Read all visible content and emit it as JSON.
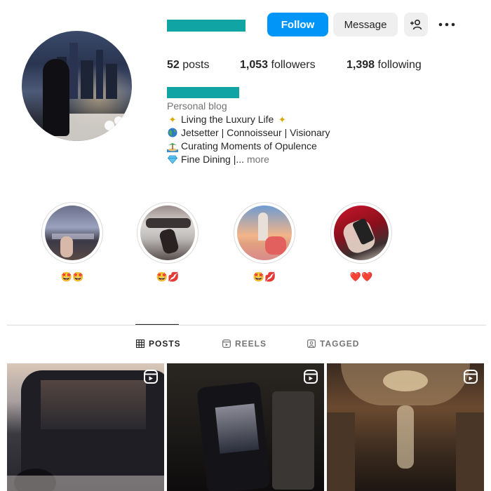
{
  "header": {
    "follow_label": "Follow",
    "message_label": "Message",
    "adduser_icon": "add-user-icon",
    "more_icon": "more-horizontal-icon"
  },
  "stats": {
    "posts_count": "52",
    "posts_label": "posts",
    "followers_count": "1,053",
    "followers_label": "followers",
    "following_count": "1,398",
    "following_label": "following"
  },
  "bio": {
    "category": "Personal blog",
    "line1": "Living the Luxury Life",
    "line2": "Jetsetter | Connoisseur | Visionary",
    "line3": "Curating Moments of Opulence",
    "line4": "Fine Dining |...",
    "more": "more"
  },
  "highlights": [
    {
      "label": "🤩🤩"
    },
    {
      "label": "🤩💋"
    },
    {
      "label": "🤩💋"
    },
    {
      "label": "❤️❤️"
    }
  ],
  "tabs": [
    {
      "label": "POSTS",
      "icon": "grid-icon"
    },
    {
      "label": "REELS",
      "icon": "reels-icon"
    },
    {
      "label": "TAGGED",
      "icon": "tagged-icon"
    }
  ],
  "colors": {
    "accent": "#0095f6",
    "redacted": "#10a4a4"
  }
}
